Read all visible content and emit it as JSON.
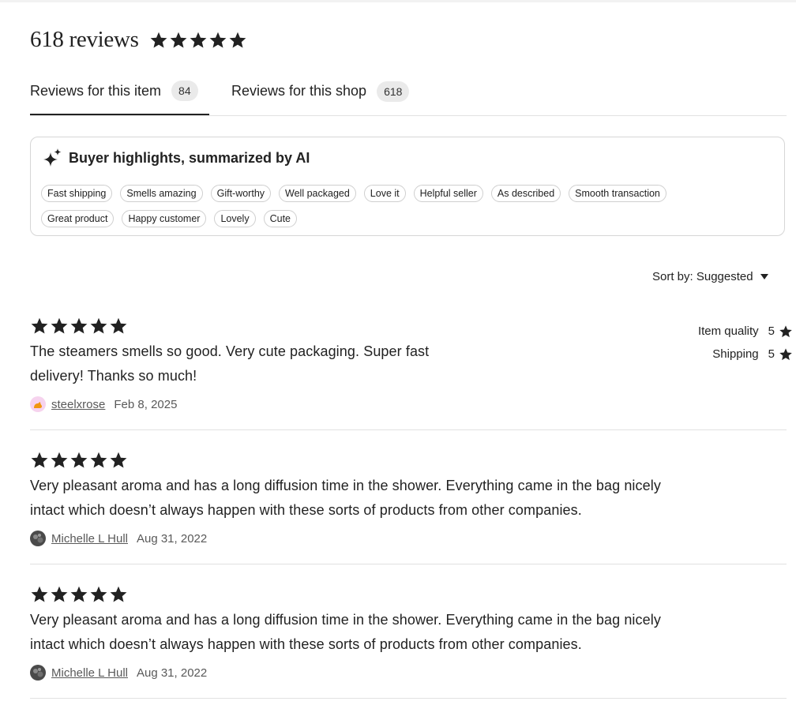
{
  "header": {
    "reviews_count": "618 reviews",
    "stars": 5
  },
  "tabs": [
    {
      "label": "Reviews for this item",
      "count": "84",
      "active": true
    },
    {
      "label": "Reviews for this shop",
      "count": "618",
      "active": false
    }
  ],
  "highlights": {
    "title": "Buyer highlights, summarized by AI",
    "icon": "sparkle-icon",
    "chips_row1": [
      "Fast shipping",
      "Smells amazing",
      "Gift-worthy",
      "Well packaged",
      "Love it",
      "Helpful seller",
      "As described",
      "Smooth transaction"
    ],
    "chips_row2": [
      "Great product",
      "Happy customer",
      "Lovely",
      "Cute"
    ]
  },
  "sort": {
    "label": "Sort by: Suggested"
  },
  "reviews": [
    {
      "stars": 5,
      "text_line1": "The steamers smells so good. Very cute packaging. Super fast",
      "text_line2": "delivery! Thanks so much!",
      "name": "steelxrose",
      "date": "Feb 8, 2025",
      "ratings": [
        {
          "label": "Item quality",
          "value": "5"
        },
        {
          "label": "Shipping",
          "value": "5"
        }
      ]
    },
    {
      "stars": 5,
      "text_line1": "Very pleasant aroma and has a long diffusion time in the shower. Everything came in the bag nicely",
      "text_line2": "intact which doesn’t always happen with these sorts of products from other companies.",
      "name": "Michelle L Hull",
      "date": "Aug 31, 2022"
    },
    {
      "stars": 5,
      "text_line1": "Very pleasant aroma and has a long diffusion time in the shower. Everything came in the bag nicely",
      "text_line2": "intact which doesn’t always happen with these sorts of products from other companies.",
      "name": "Michelle L Hull",
      "date": "Aug 31, 2022"
    }
  ],
  "colors": {
    "text": "#222222",
    "muted": "#595959",
    "border": "#e1e1e1",
    "badge_bg": "#eaeaea",
    "avatar1_bg": "#f6d3ee",
    "avatar1_fg": "#f0960f",
    "avatar2_bg": "#4a4a4a"
  }
}
